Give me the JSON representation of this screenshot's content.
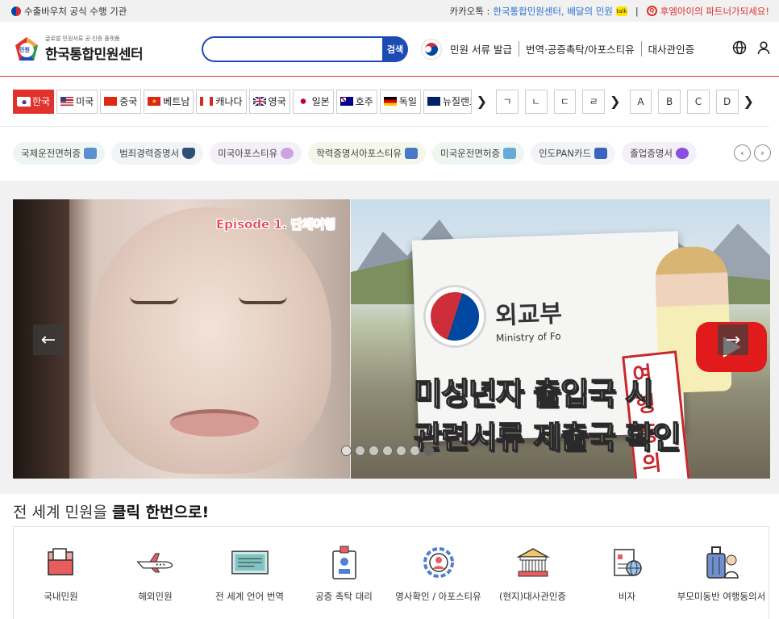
{
  "topbar": {
    "left_text": "수출바우처 공식 수행 기관",
    "kakao_prefix": "카카오톡 :",
    "kakao_links": "한국통합민원센터, 배달의 민원",
    "kakao_badge": "talk",
    "sponsor_text": "후엠아이의 파트너가되세요!"
  },
  "header": {
    "logo_small": "글로벌 민원서류 공·인증 플랫폼",
    "logo_big": "한국통합민원센터",
    "logo_badge": "민원",
    "search_placeholder": "",
    "search_button": "검색",
    "links": [
      "민원 서류 발급",
      "번역·공증촉탁/아포스티유",
      "대사관인증"
    ]
  },
  "countries": {
    "tabs": [
      {
        "label": "한국",
        "active": true
      },
      {
        "label": "미국",
        "active": false
      },
      {
        "label": "중국",
        "active": false
      },
      {
        "label": "베트남",
        "active": false
      },
      {
        "label": "캐나다",
        "active": false
      },
      {
        "label": "영국",
        "active": false
      },
      {
        "label": "일본",
        "active": false
      },
      {
        "label": "호주",
        "active": false
      },
      {
        "label": "독일",
        "active": false
      },
      {
        "label": "뉴질랜드",
        "active": false
      }
    ],
    "korean_letters": [
      "ㄱ",
      "ㄴ",
      "ㄷ",
      "ㄹ"
    ],
    "latin_letters": [
      "A",
      "B",
      "C",
      "D"
    ]
  },
  "doc_chips": [
    {
      "label": "국제운전면허증",
      "bg": "#eef6f2",
      "icon_color": "#5b8fd0"
    },
    {
      "label": "범죄경력증명서",
      "bg": "#f2f4f8",
      "icon_color": "#2e4f7a"
    },
    {
      "label": "미국아포스티유",
      "bg": "#f4f0fa",
      "icon_color": "#c9a4e0"
    },
    {
      "label": "학력증명서아포스티유",
      "bg": "#f5f7ea",
      "icon_color": "#4a78c8"
    },
    {
      "label": "미국운전면허증",
      "bg": "#eef6f2",
      "icon_color": "#6aa8d8"
    },
    {
      "label": "인도PAN카드",
      "bg": "#f2f4f8",
      "icon_color": "#3a64c0"
    },
    {
      "label": "졸업증명서",
      "bg": "#f4f0fa",
      "icon_color": "#8a4ee0"
    }
  ],
  "hero": {
    "episode": "Episode 1. 단체여행",
    "mofa_ko": "외교부",
    "mofa_en": "Ministry of Fo",
    "stamp": "여행동의서",
    "title_line1": "미성년자 출입국 시",
    "title_line2": "관련서류 제출국 확인",
    "prev": "←",
    "next": "→",
    "dot_count": 7,
    "active_dot": 6
  },
  "services": {
    "title_normal": "전 세계 민원을 ",
    "title_bold": "클릭 한번으로!",
    "items": [
      {
        "label": "국내민원",
        "icon": "folder-icon"
      },
      {
        "label": "해외민원",
        "icon": "airplane-icon"
      },
      {
        "label": "전 세계 언어 번역",
        "icon": "document-icon"
      },
      {
        "label": "공증 촉탁 대리",
        "icon": "id-badge-icon"
      },
      {
        "label": "영사확인 / 아포스티유",
        "icon": "gear-person-icon"
      },
      {
        "label": "(현지)대사관인증",
        "icon": "embassy-icon"
      },
      {
        "label": "비자",
        "icon": "visa-icon"
      },
      {
        "label": "부모미동반 여행동의서",
        "icon": "luggage-icon"
      }
    ]
  },
  "colors": {
    "accent_red": "#e1322d",
    "accent_blue": "#1d4bb5"
  }
}
